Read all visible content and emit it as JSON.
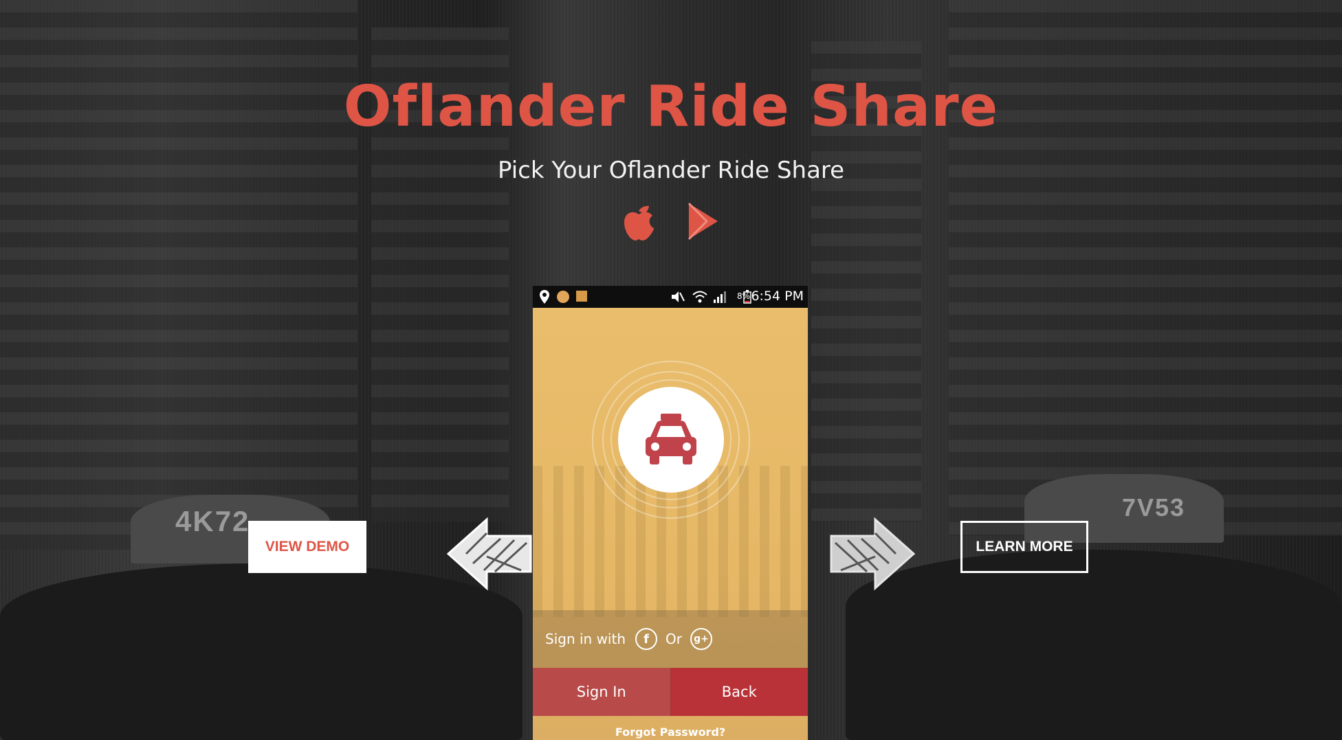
{
  "hero": {
    "title": "Oflander Ride Share",
    "subtitle": "Pick Your Oflander Ride Share"
  },
  "store_icons": [
    "apple-icon",
    "google-play-icon"
  ],
  "buttons": {
    "view_demo": "VIEW DEMO",
    "learn_more": "LEARN MORE"
  },
  "background": {
    "plate_left": "4K72",
    "plate_right": "7V53"
  },
  "phone": {
    "status": {
      "battery": "8%",
      "time": "6:54 PM"
    },
    "sign_in_with": "Sign in with",
    "or": "Or",
    "facebook_glyph": "f",
    "google_glyph": "g+",
    "sign_in": "Sign In",
    "back": "Back",
    "forgot_password": "Forgot Password?"
  },
  "colors": {
    "accent": "#de5546",
    "screen_bg": "#e9bd6c",
    "sign_in_bg": "#b84a49",
    "back_bg": "#b83238"
  }
}
